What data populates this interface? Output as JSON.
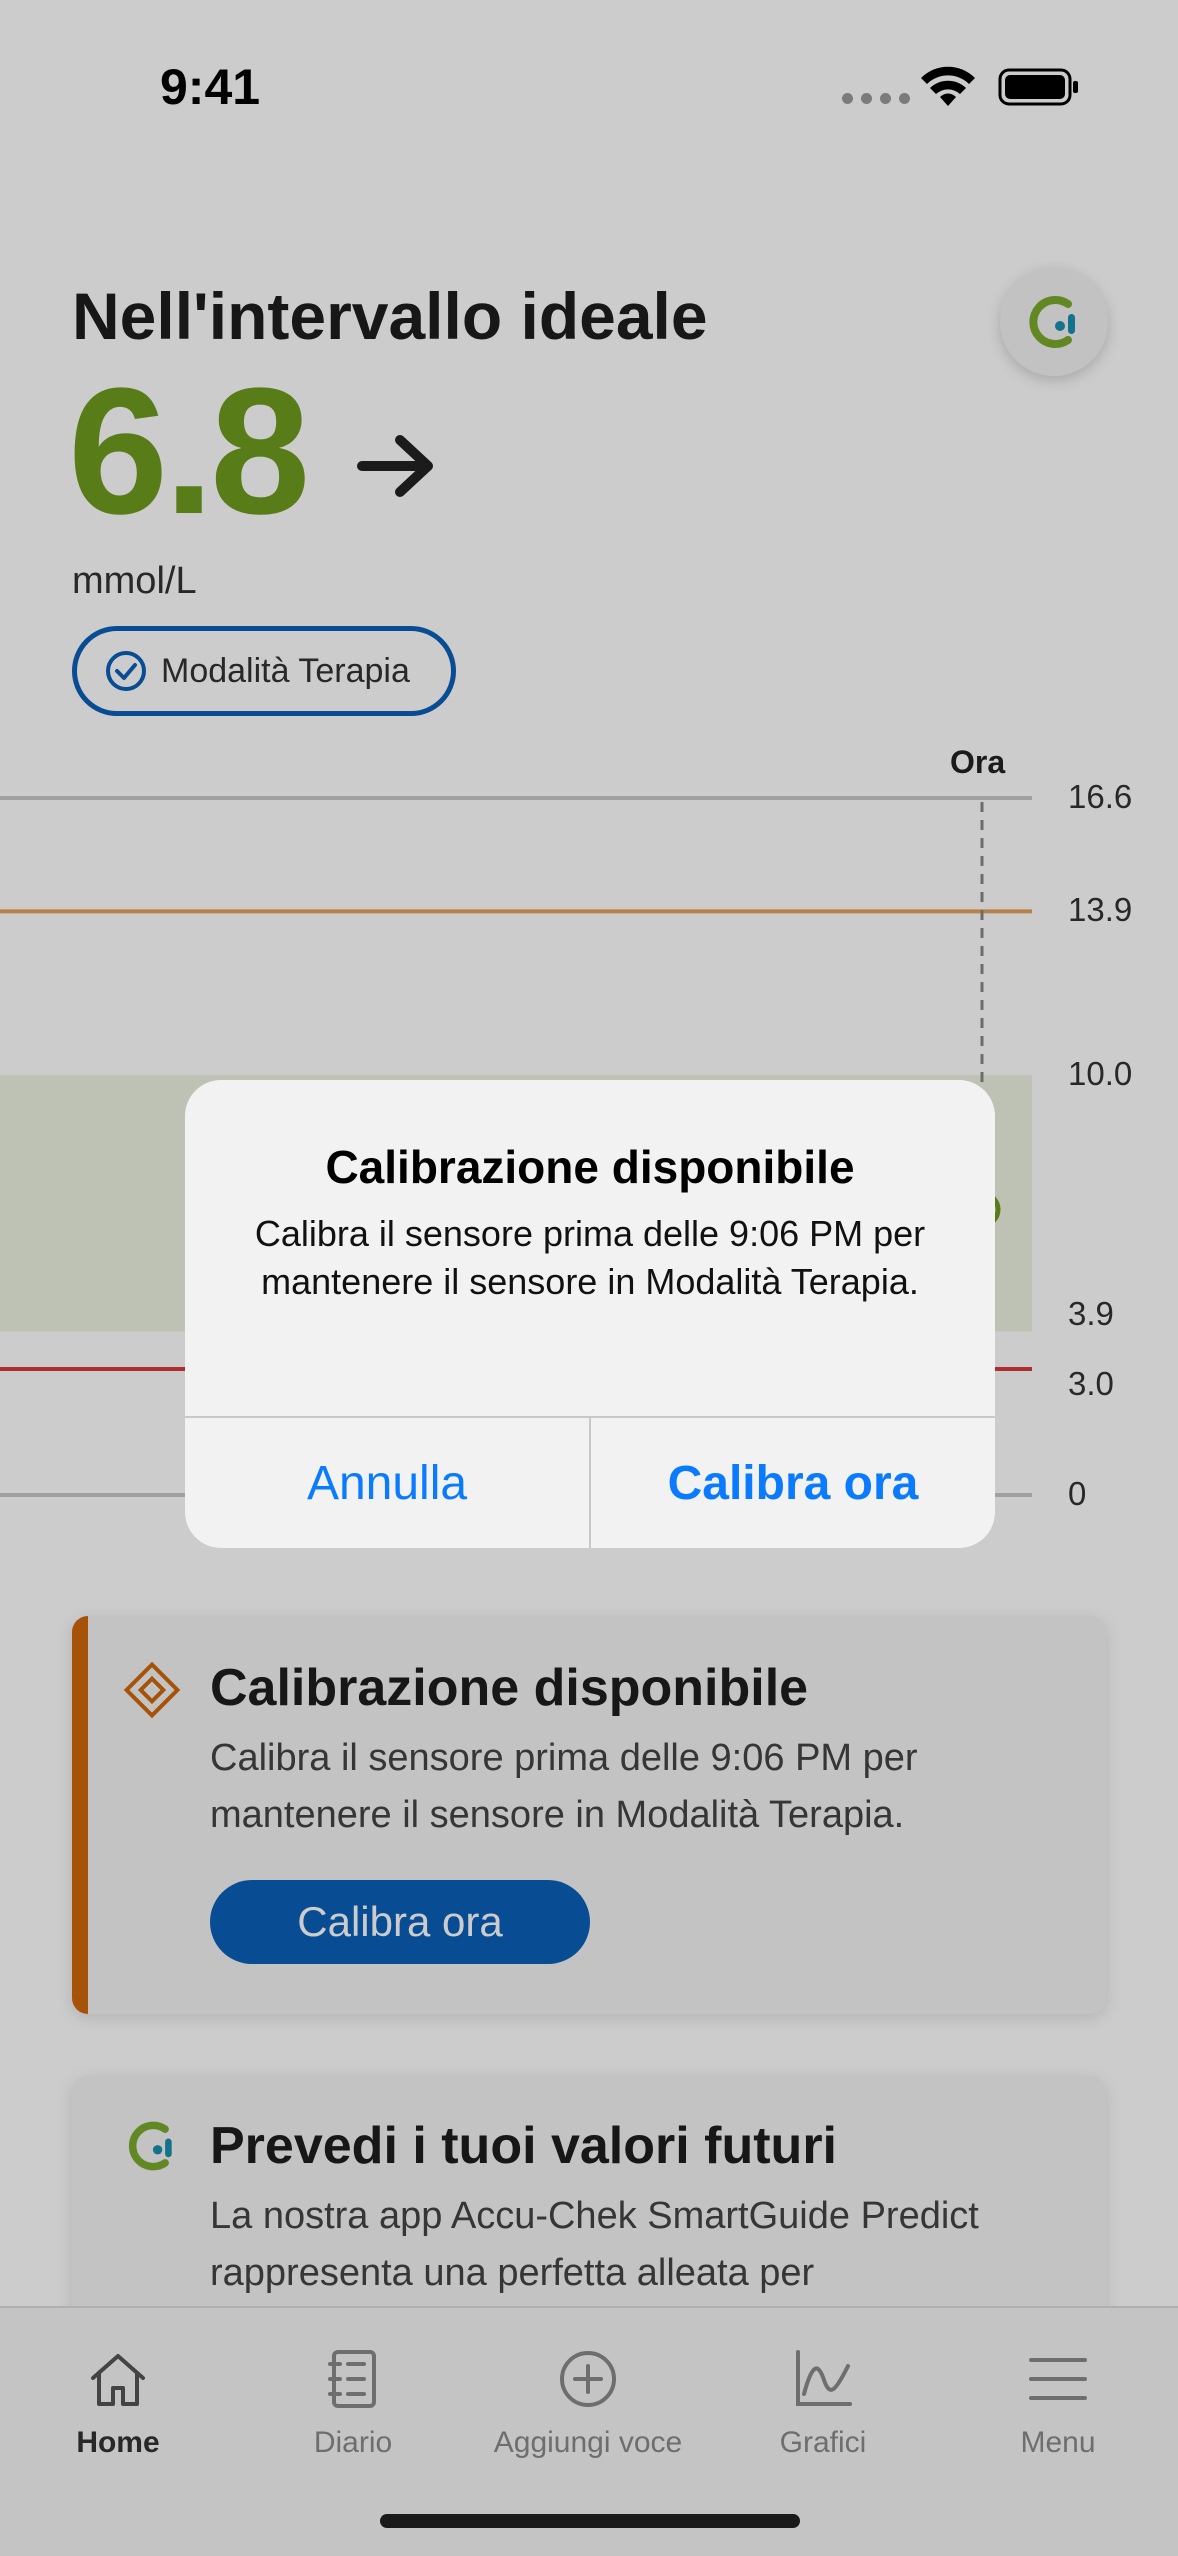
{
  "status": {
    "time": "9:41"
  },
  "header": {
    "title": "Nell'intervallo ideale",
    "glucose_value": "6.8",
    "unit": "mmol/L",
    "mode": "Modalità Terapia"
  },
  "chart": {
    "now_label": "Ora",
    "ticks": [
      "16.6",
      "13.9",
      "10.0",
      "3.9",
      "3.0",
      "0"
    ]
  },
  "chart_data": {
    "type": "line",
    "title": "",
    "xlabel": "",
    "ylabel": "",
    "ylim": [
      0,
      16.6
    ],
    "y_ticks": [
      16.6,
      13.9,
      10.0,
      3.9,
      3.0,
      0
    ],
    "target_range": [
      3.9,
      10.0
    ],
    "thresholds": {
      "high": 13.9,
      "low": 3.0
    },
    "series": [],
    "colors": {
      "high_line": "#e8a15c",
      "low_line": "#d83a3a",
      "target_band": "#eef3e1",
      "grid": "#c8c8c8"
    }
  },
  "cards": [
    {
      "title": "Calibrazione disponibile",
      "body": "Calibra il sensore prima delle 9:06 PM per mantenere il sensore in Modalità Terapia.",
      "button": "Calibra ora"
    },
    {
      "title": "Prevedi i tuoi valori futuri",
      "body": "La nostra app Accu-Chek SmartGuide Predict rappresenta una perfetta alleata per"
    }
  ],
  "tabs": [
    {
      "label": "Home",
      "icon": "home-icon",
      "active": true
    },
    {
      "label": "Diario",
      "icon": "diary-icon",
      "active": false
    },
    {
      "label": "Aggiungi voce",
      "icon": "add-entry-icon",
      "active": false
    },
    {
      "label": "Grafici",
      "icon": "chart-icon",
      "active": false
    },
    {
      "label": "Menu",
      "icon": "menu-icon",
      "active": false
    }
  ],
  "alert": {
    "title": "Calibrazione disponibile",
    "message": "Calibra il sensore prima delle 9:06 PM per mantenere il sensore in Modalità Terapia.",
    "cancel_label": "Annulla",
    "confirm_label": "Calibra ora"
  },
  "colors": {
    "glucose_green": "#6f9b1f",
    "primary_blue": "#0b5fb8",
    "alert_blue": "#0a7aff",
    "warning_orange": "#d0670a"
  }
}
